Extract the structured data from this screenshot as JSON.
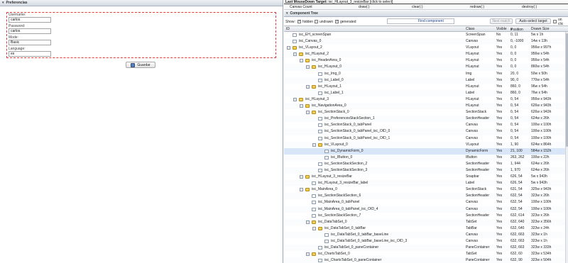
{
  "left": {
    "section_title": "Preferencias",
    "fields": [
      {
        "label": "Username:",
        "value": "carlos"
      },
      {
        "label": "Password:",
        "value": "carlos"
      },
      {
        "label": "Mode:",
        "value": "Basic"
      },
      {
        "label": "Language:",
        "value": "es"
      }
    ],
    "save_label": "Guardar"
  },
  "right": {
    "target_label": "Last MouseDown Target:",
    "target_value": "isc_HLayout_3_resizeBar",
    "target_hint": "[click to select]",
    "counts": [
      {
        "label": "Canvas Count",
        "link": "draw(:)"
      },
      {
        "label": "",
        "link": "clear(:)"
      },
      {
        "label": "",
        "link": "redraw(:)"
      },
      {
        "label": "",
        "link": "destroy(:)"
      }
    ],
    "tree_title": "Component Tree",
    "toolbar": {
      "show_label": "Show:",
      "hidden_label": "hidden",
      "undrawn_label": "undrawn",
      "generated_label": "generated",
      "find_label": "Find component",
      "next_label": "Next match",
      "autoselect_label": "Auto-select target",
      "onclick_label": "on clic"
    },
    "columns": [
      "ID",
      "Class",
      "Visible",
      "Position",
      "Drawn Size"
    ],
    "rows": [
      {
        "id": "isc_EH_screenSpan",
        "cls": "ScreenSpan",
        "vis": "No",
        "pos": "0, 11",
        "size": "5w x 1h",
        "depth": 0,
        "kind": "file"
      },
      {
        "id": "isc_Canvas_0",
        "cls": "Canvas",
        "vis": "Yes",
        "pos": "0, -1000",
        "size": "14w x 13h",
        "depth": 0,
        "kind": "file"
      },
      {
        "id": "isc_VLayout_2",
        "cls": "VLayout",
        "vis": "Yes",
        "pos": "0, 0",
        "size": "956w x 997h",
        "depth": 0,
        "kind": "folder",
        "tog": "-"
      },
      {
        "id": "isc_HLayout_2",
        "cls": "HLayout",
        "vis": "Yes",
        "pos": "0, 0",
        "size": "956w x 54h",
        "depth": 1,
        "kind": "folder",
        "tog": "-"
      },
      {
        "id": "isc_HeaderArea_0",
        "cls": "HLayout",
        "vis": "Yes",
        "pos": "0, 0",
        "size": "956w x 54h",
        "depth": 2,
        "kind": "folder",
        "tog": "-"
      },
      {
        "id": "isc_HLayout_0",
        "cls": "HLayout",
        "vis": "Yes",
        "pos": "0, 0",
        "size": "860w x 54h",
        "depth": 3,
        "kind": "folder",
        "tog": "-"
      },
      {
        "id": "isc_Img_0",
        "cls": "Img",
        "vis": "Yes",
        "pos": "20, 0",
        "size": "50w x 50h",
        "depth": 4,
        "kind": "file"
      },
      {
        "id": "isc_Label_0",
        "cls": "Label",
        "vis": "Yes",
        "pos": "90, 0",
        "size": "770w x 54h",
        "depth": 4,
        "kind": "file"
      },
      {
        "id": "isc_HLayout_1",
        "cls": "HLayout",
        "vis": "Yes",
        "pos": "860, 0",
        "size": "96w x 54h",
        "depth": 3,
        "kind": "folder",
        "tog": "-"
      },
      {
        "id": "isc_Label_1",
        "cls": "Label",
        "vis": "Yes",
        "pos": "860, 0",
        "size": "76w x 54h",
        "depth": 4,
        "kind": "file"
      },
      {
        "id": "isc_HLayout_3",
        "cls": "HLayout",
        "vis": "Yes",
        "pos": "0, 54",
        "size": "956w x 943h",
        "depth": 1,
        "kind": "folder",
        "tog": "-"
      },
      {
        "id": "isc_NavigationArea_0",
        "cls": "HLayout",
        "vis": "Yes",
        "pos": "0, 54",
        "size": "626w x 943h",
        "depth": 2,
        "kind": "folder",
        "tog": "-"
      },
      {
        "id": "isc_SectionStack_0",
        "cls": "SectionStack",
        "vis": "Yes",
        "pos": "0, 54",
        "size": "626w x 943h",
        "depth": 3,
        "kind": "folder",
        "tog": "-"
      },
      {
        "id": "isc_PreferencesStackSection_1",
        "cls": "SectionHeader",
        "vis": "Yes",
        "pos": "0, 54",
        "size": "624w x 26h",
        "depth": 4,
        "kind": "file"
      },
      {
        "id": "isc_SectionStack_0_tabPanel",
        "cls": "Canvas",
        "vis": "Yes",
        "pos": "0, 54",
        "size": "100w x 100h",
        "depth": 4,
        "kind": "file"
      },
      {
        "id": "isc_SectionStack_0_tabPanel_isc_OID_0",
        "cls": "Canvas",
        "vis": "Yes",
        "pos": "0, 54",
        "size": "100w x 100h",
        "depth": 4,
        "kind": "file"
      },
      {
        "id": "isc_SectionStack_0_tabPanel_isc_OID_1",
        "cls": "Canvas",
        "vis": "Yes",
        "pos": "0, 54",
        "size": "100w x 100h",
        "depth": 4,
        "kind": "file"
      },
      {
        "id": "isc_VLayout_0",
        "cls": "VLayout",
        "vis": "Yes",
        "pos": "1, 90",
        "size": "624w x 864h",
        "depth": 4,
        "kind": "folder",
        "tog": "-"
      },
      {
        "id": "isc_DynamicForm_0",
        "cls": "DynamicForm",
        "vis": "Yes",
        "pos": "21, 100",
        "size": "584w x 152h",
        "depth": 5,
        "kind": "file",
        "sel": true
      },
      {
        "id": "isc_IButton_0",
        "cls": "IButton",
        "vis": "Yes",
        "pos": "263, 262",
        "size": "100w x 22h",
        "depth": 5,
        "kind": "file"
      },
      {
        "id": "isc_SectionStackSection_2",
        "cls": "SectionHeader",
        "vis": "Yes",
        "pos": "1, 944",
        "size": "624w x 26h",
        "depth": 4,
        "kind": "file"
      },
      {
        "id": "isc_SectionStackSection_3",
        "cls": "SectionHeader",
        "vis": "Yes",
        "pos": "1, 970",
        "size": "624w x 26h",
        "depth": 4,
        "kind": "file"
      },
      {
        "id": "isc_HLayout_3_resizeBar",
        "cls": "Snapbar",
        "vis": "Yes",
        "pos": "626, 54",
        "size": "5w x 943h",
        "depth": 2,
        "kind": "folder",
        "tog": "-"
      },
      {
        "id": "isc_HLayout_3_resizeBar_label",
        "cls": "Label",
        "vis": "Yes",
        "pos": "626, 54",
        "size": "5w x 943h",
        "depth": 3,
        "kind": "file"
      },
      {
        "id": "isc_MainArea_0",
        "cls": "SectionStack",
        "vis": "Yes",
        "pos": "631, 54",
        "size": "325w x 943h",
        "depth": 2,
        "kind": "folder",
        "tog": "-"
      },
      {
        "id": "isc_SectionStackSection_6",
        "cls": "SectionHeader",
        "vis": "Yes",
        "pos": "632, 54",
        "size": "323w x 26h",
        "depth": 3,
        "kind": "file"
      },
      {
        "id": "isc_MainArea_0_tabPanel",
        "cls": "Canvas",
        "vis": "Yes",
        "pos": "632, 54",
        "size": "100w x 100h",
        "depth": 3,
        "kind": "file"
      },
      {
        "id": "isc_MainArea_0_tabPanel_isc_OID_4",
        "cls": "Canvas",
        "vis": "Yes",
        "pos": "632, 54",
        "size": "100w x 100h",
        "depth": 3,
        "kind": "file"
      },
      {
        "id": "isc_SectionStackSection_7",
        "cls": "SectionHeader",
        "vis": "Yes",
        "pos": "632, 614",
        "size": "323w x 26h",
        "depth": 3,
        "kind": "file"
      },
      {
        "id": "isc_DataTabSet_0",
        "cls": "TabSet",
        "vis": "Yes",
        "pos": "632, 640",
        "size": "323w x 356h",
        "depth": 3,
        "kind": "folder",
        "tog": "-"
      },
      {
        "id": "isc_DataTabSet_0_tabBar",
        "cls": "TabBar",
        "vis": "Yes",
        "pos": "632, 640",
        "size": "323w x 24h",
        "depth": 4,
        "kind": "folder",
        "tog": "-"
      },
      {
        "id": "isc_DataTabSet_0_tabBar_baseLine",
        "cls": "Canvas",
        "vis": "Yes",
        "pos": "632, 663",
        "size": "323w x 1h",
        "depth": 5,
        "kind": "file"
      },
      {
        "id": "isc_DataTabSet_0_tabBar_baseLine_isc_OID_3",
        "cls": "Canvas",
        "vis": "Yes",
        "pos": "632, 663",
        "size": "323w x 1h",
        "depth": 5,
        "kind": "file"
      },
      {
        "id": "isc_DataTabSet_0_paneContainer",
        "cls": "PaneContainer",
        "vis": "Yes",
        "pos": "632, 663",
        "size": "323w x 333h",
        "depth": 4,
        "kind": "file"
      },
      {
        "id": "isc_ChartsTabSet_0",
        "cls": "TabSet",
        "vis": "Yes",
        "pos": "632, 60",
        "size": "323w x 534h",
        "depth": 3,
        "kind": "folder",
        "tog": "-"
      },
      {
        "id": "isc_ChartsTabSet_0_paneContainer",
        "cls": "PaneContainer",
        "vis": "Yes",
        "pos": "632, 90",
        "size": "323w x 504h",
        "depth": 4,
        "kind": "file"
      }
    ]
  }
}
